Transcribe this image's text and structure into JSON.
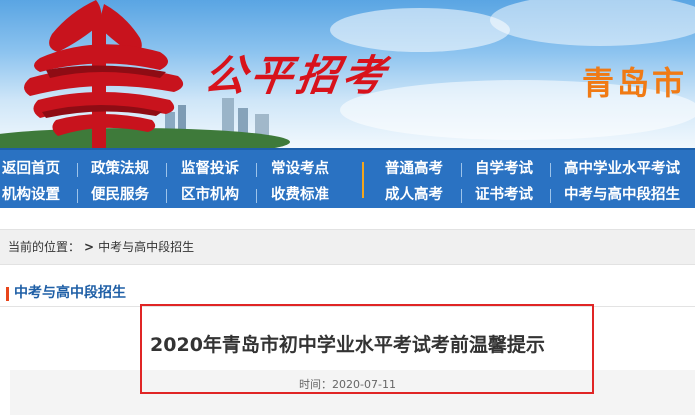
{
  "banner": {
    "slogan": "公平招考",
    "city": "青岛市"
  },
  "nav": {
    "row1": [
      "返回首页",
      "政策法规",
      "监督投诉",
      "常设考点",
      "普通高考",
      "自学考试",
      "高中学业水平考试"
    ],
    "row2": [
      "机构设置",
      "便民服务",
      "区市机构",
      "收费标准",
      "成人高考",
      "证书考试",
      "中考与高中段招生"
    ]
  },
  "breadcrumb": {
    "label": "当前的位置：",
    "arrow": ">",
    "current": "中考与高中段招生"
  },
  "section": {
    "title": "中考与高中段招生"
  },
  "article": {
    "title": "2020年青岛市初中学业水平考试考前温馨提示",
    "time": "时间：2020-07-11"
  },
  "colors": {
    "nav_bg": "#2a72c2",
    "slogan": "#d8121b",
    "city": "#f07a14",
    "section_title": "#1f5fa6",
    "highlight": "#e02525"
  }
}
